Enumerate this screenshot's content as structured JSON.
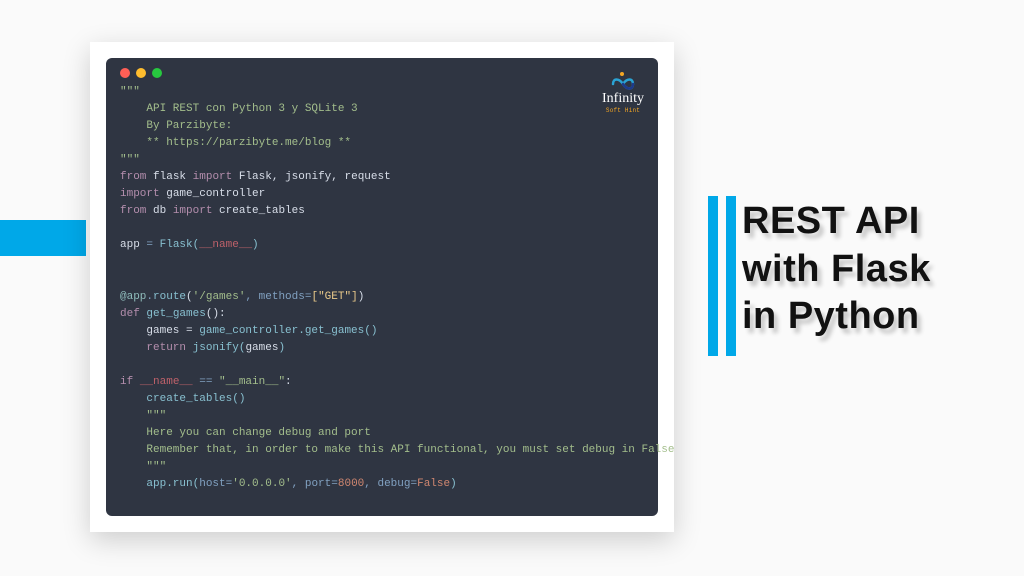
{
  "brand": {
    "name": "Infinity",
    "subtitle": "Soft Hint"
  },
  "title": {
    "line1": "REST API",
    "line2": "with Flask",
    "line3": "in Python"
  },
  "code": {
    "doc1": "    API REST con Python 3 y SQLite 3",
    "doc2": "    By Parzibyte:",
    "doc3": "    ** https://parzibyte.me/blog **",
    "tq": "\"\"\"",
    "from": "from",
    "import": "import",
    "flask": "flask",
    "Flask": "Flask",
    "jsonify": "jsonify",
    "request": "request",
    "game_controller": "game_controller",
    "db": "db",
    "create_tables": "create_tables",
    "app": "app",
    "eq": " = ",
    "FlaskCall_open": "Flask(",
    "dunder_name": "__name__",
    "paren_close": ")",
    "decorator": "@app",
    "dot": ".",
    "route": "route",
    "route_args_open": "(",
    "route_path": "'/games'",
    "methods_kw": ", methods=",
    "methods_val": "[\"GET\"]",
    "def": "def",
    "get_games": "get_games",
    "colon": ":",
    "games_assign": "    games = ",
    "gc_call": "game_controller.get_games()",
    "return": "return",
    "jsonify_call_open": " jsonify(",
    "games": "games",
    "if": "if",
    "main_str": "\"__main__\"",
    "eqeq": " == ",
    "ct_call": "    create_tables()",
    "cmt1": "    Here you can change debug and port",
    "cmt2": "    Remember that, in order to make this API functional, you must set debug in False",
    "run_open": "    app.run(",
    "host_kw": "host=",
    "host_val": "'0.0.0.0'",
    "port_kw": ", port=",
    "port_val": "8000",
    "debug_kw": ", debug=",
    "debug_val": "False"
  }
}
